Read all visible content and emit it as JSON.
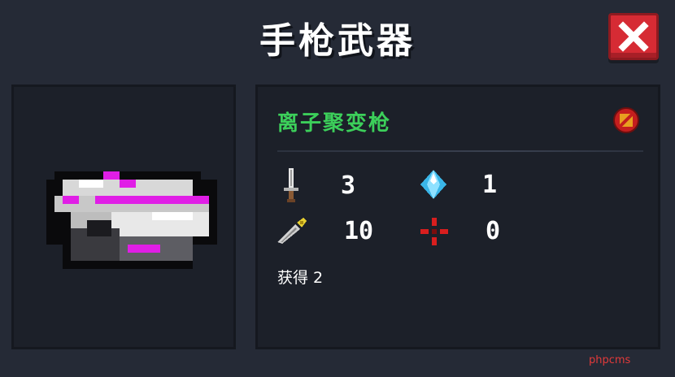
{
  "header": {
    "title": "手枪武器"
  },
  "close": {
    "icon": "close-x-icon",
    "color": "#d62b34"
  },
  "weapon": {
    "name": "离子聚变枪",
    "name_color": "#3ccf5a",
    "art_icon": "ion-fusion-gun-pixel-icon",
    "badge_icon": "no-trade-badge-icon",
    "stats": {
      "damage": {
        "icon": "sword-icon",
        "value": "3"
      },
      "energy": {
        "icon": "blue-crystal-icon",
        "value": "1"
      },
      "crit": {
        "icon": "knife-icon",
        "value": "10"
      },
      "spread": {
        "icon": "red-crosshair-icon",
        "value": "0"
      }
    },
    "obtained_label": "获得 2"
  },
  "watermark": "phpcms"
}
